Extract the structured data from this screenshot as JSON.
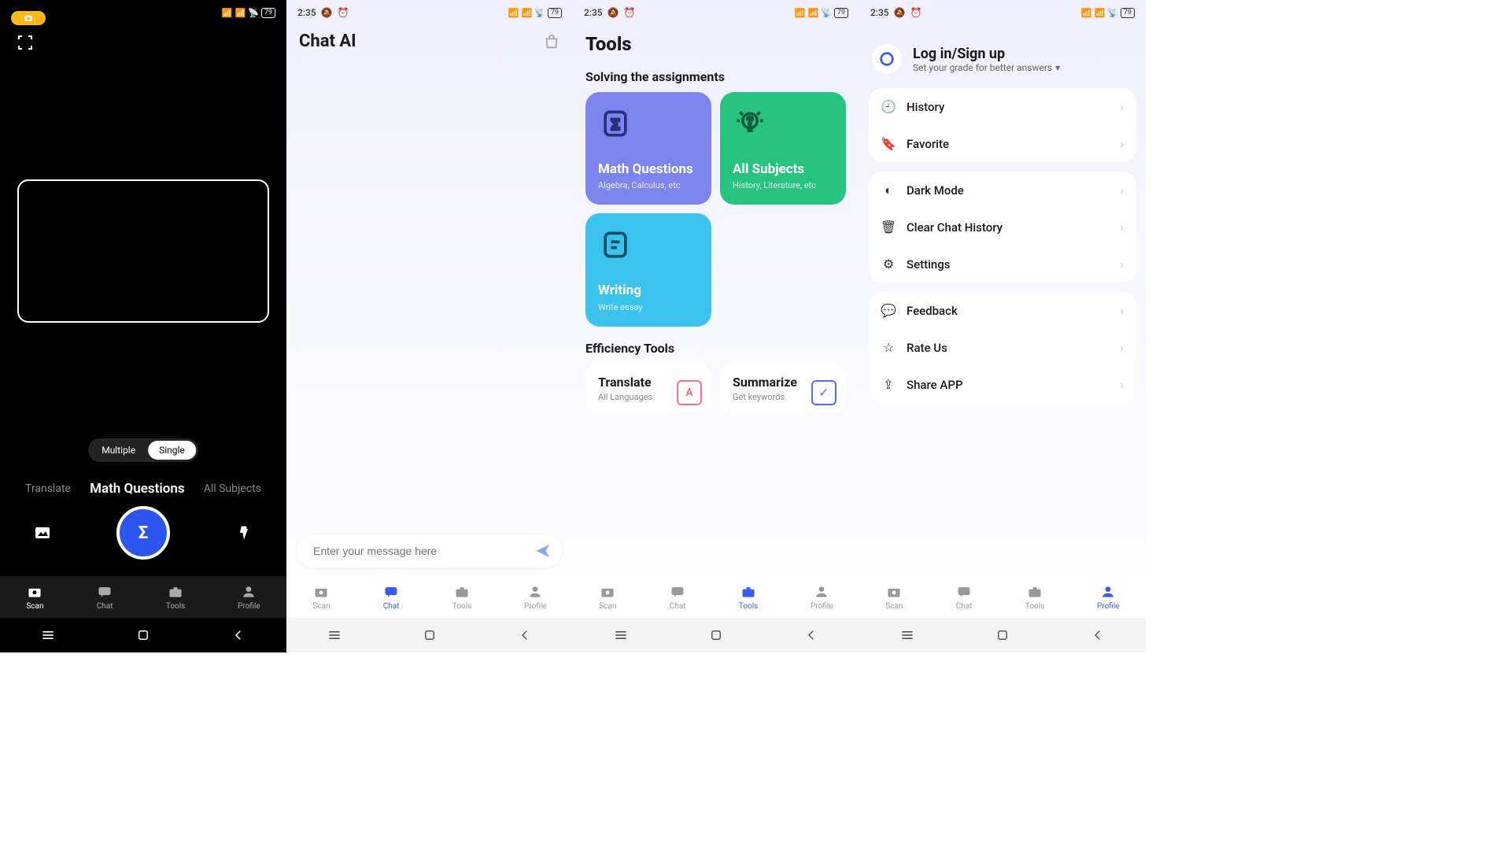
{
  "status": {
    "time": "2:35",
    "battery": "79"
  },
  "tabs": {
    "scan": "Scan",
    "chat": "Chat",
    "tools": "Tools",
    "profile": "Profile"
  },
  "screen1": {
    "segment_multiple": "Multiple",
    "segment_single": "Single",
    "mode_translate": "Translate",
    "mode_math": "Math Questions",
    "mode_all": "All Subjects"
  },
  "screen2": {
    "title": "Chat AI",
    "input_placeholder": "Enter your message here"
  },
  "screen3": {
    "title": "Tools",
    "section1": "Solving the assignments",
    "card_math_title": "Math Questions",
    "card_math_sub": "Algebra, Calculus, etc",
    "card_subjects_title": "All Subjects",
    "card_subjects_sub": "History, Literature, etc",
    "card_writing_title": "Writing",
    "card_writing_sub": "Write essay",
    "section2": "Efficiency Tools",
    "card_translate_title": "Translate",
    "card_translate_sub": "All Languages",
    "card_summarize_title": "Summarize",
    "card_summarize_sub": "Get keywords"
  },
  "screen4": {
    "login_title": "Log in/Sign up",
    "login_sub": "Set your grade for better answers",
    "menu_history": "History",
    "menu_favorite": "Favorite",
    "menu_dark": "Dark Mode",
    "menu_clear": "Clear Chat History",
    "menu_settings": "Settings",
    "menu_feedback": "Feedback",
    "menu_rate": "Rate Us",
    "menu_share": "Share APP"
  }
}
